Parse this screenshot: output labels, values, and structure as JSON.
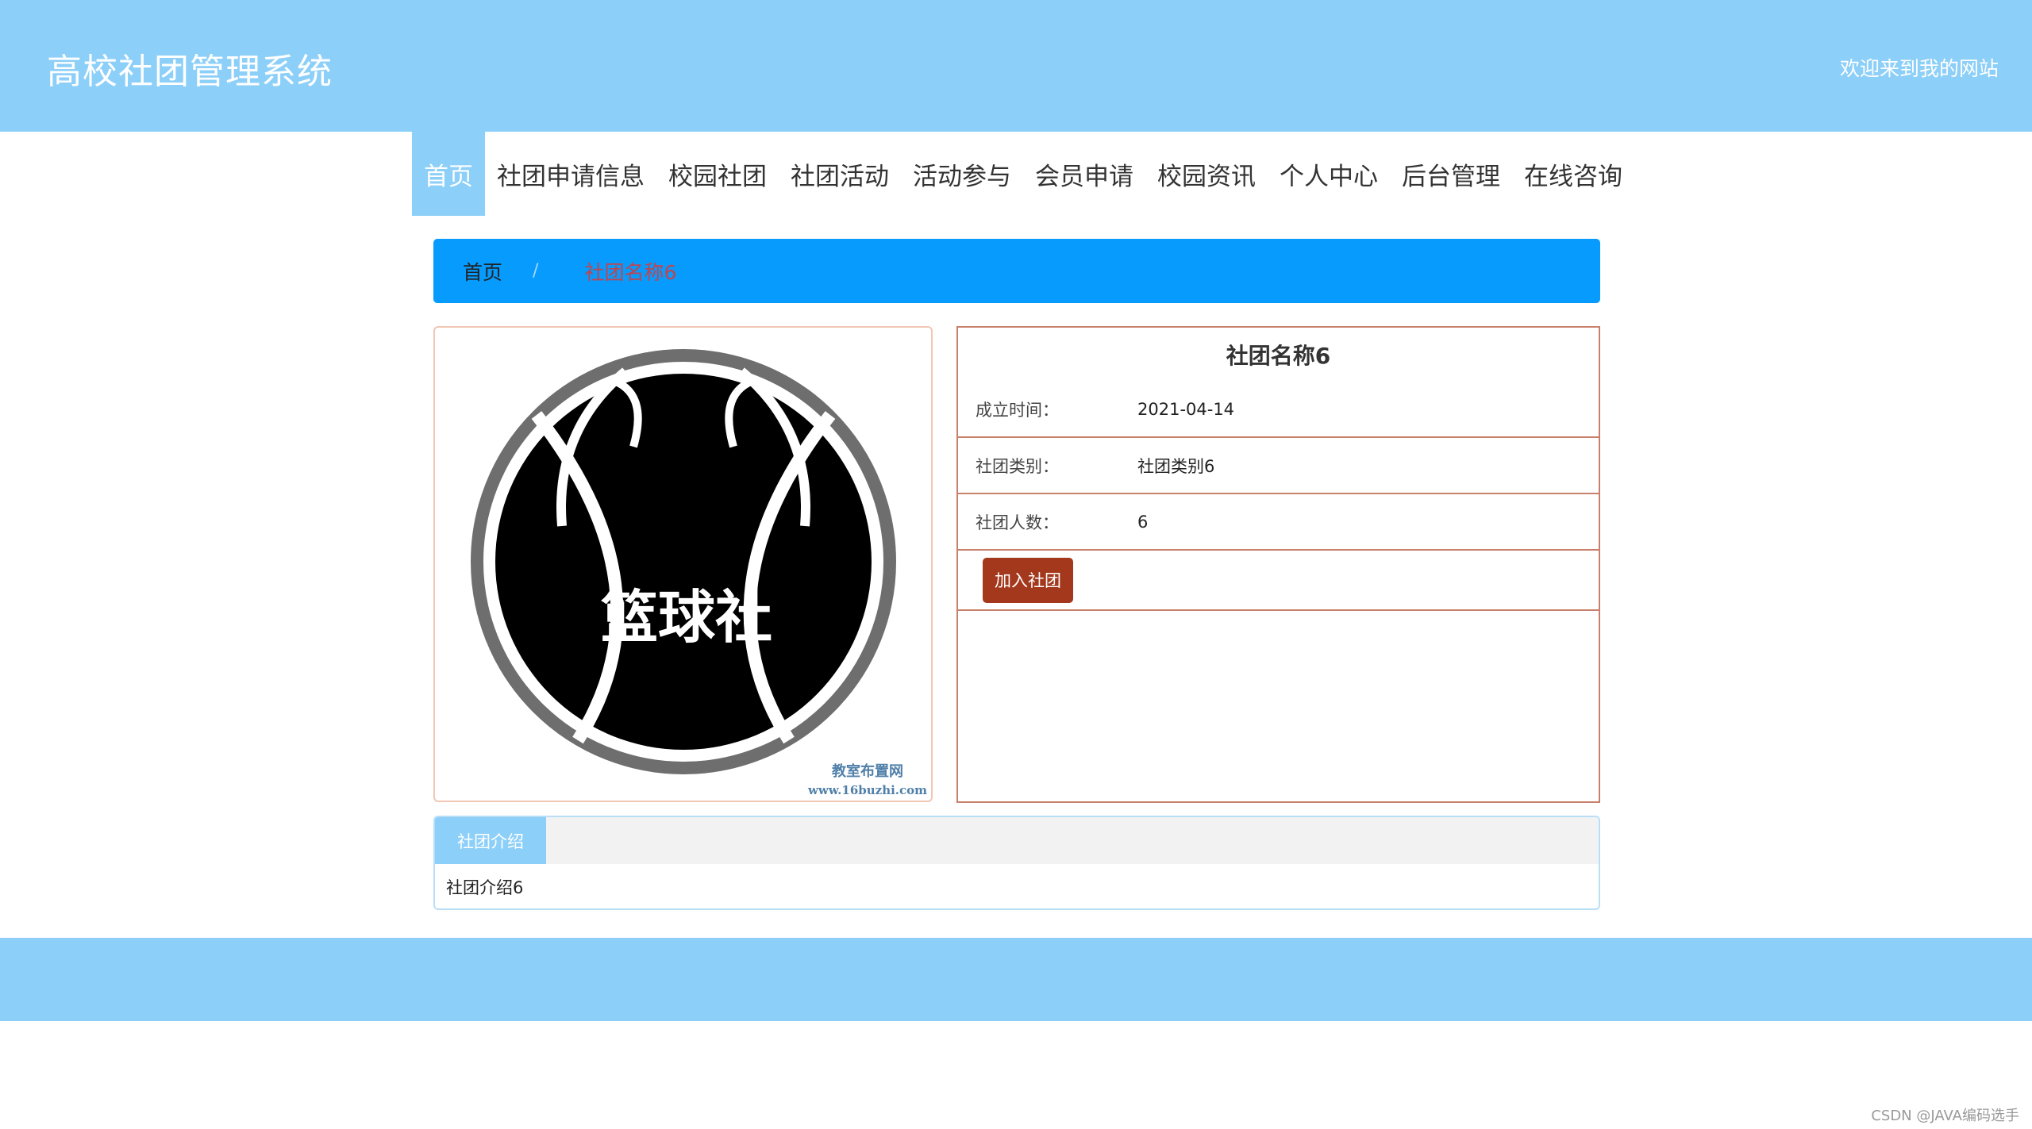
{
  "header": {
    "site_title": "高校社团管理系统",
    "welcome": "欢迎来到我的网站"
  },
  "nav": {
    "items": [
      "首页",
      "社团申请信息",
      "校园社团",
      "社团活动",
      "活动参与",
      "会员申请",
      "校园资讯",
      "个人中心",
      "后台管理",
      "在线咨询"
    ],
    "active_index": 0
  },
  "breadcrumb": {
    "home": "首页",
    "separator": "/",
    "current": "社团名称6"
  },
  "club": {
    "name": "社团名称6",
    "image": {
      "logo_text": "篮球社",
      "watermark_line1": "教室布置网",
      "watermark_line2": "www.16buzhi.com"
    },
    "fields": [
      {
        "label": "成立时间：",
        "value": "2021-04-14"
      },
      {
        "label": "社团类别：",
        "value": "社团类别6"
      },
      {
        "label": "社团人数：",
        "value": "6"
      }
    ],
    "join_button": "加入社团"
  },
  "intro": {
    "tab_label": "社团介绍",
    "content": "社团介绍6"
  },
  "watermark": "CSDN @JAVA编码选手",
  "colors": {
    "header_bg": "#8ccff8",
    "breadcrumb_bg": "#069bfd",
    "breadcrumb_current": "#c0454e",
    "join_button": "#a4381c",
    "info_border": "#c9806a"
  }
}
